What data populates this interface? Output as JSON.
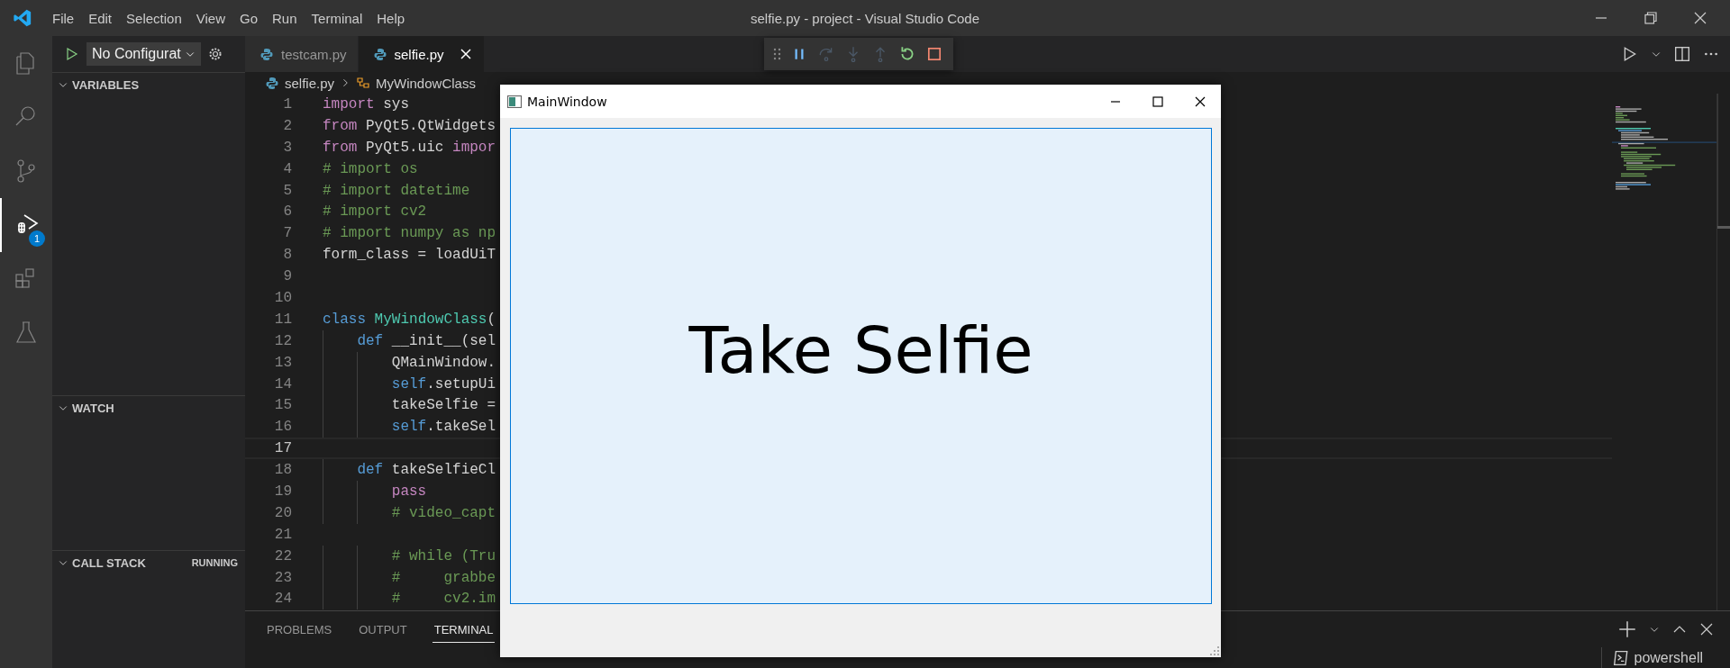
{
  "window": {
    "title": "selfie.py - project - Visual Studio Code",
    "menu": [
      "File",
      "Edit",
      "Selection",
      "View",
      "Go",
      "Run",
      "Terminal",
      "Help"
    ]
  },
  "activity_bar": [
    {
      "kind": "explorer",
      "selected": false
    },
    {
      "kind": "search",
      "selected": false
    },
    {
      "kind": "source_control",
      "selected": false
    },
    {
      "kind": "run_debug",
      "selected": true,
      "badge": "1"
    },
    {
      "kind": "extensions",
      "selected": false
    },
    {
      "kind": "testing",
      "selected": false
    }
  ],
  "debug_config": {
    "value": "No Configurat"
  },
  "sidebar": {
    "sections": [
      {
        "title": "VARIABLES",
        "expanded": true
      },
      {
        "title": "WATCH",
        "expanded": true
      },
      {
        "title": "CALL STACK",
        "expanded": true,
        "status": "RUNNING"
      }
    ]
  },
  "tabs": [
    {
      "label": "testcam.py",
      "selected": false
    },
    {
      "label": "selfie.py",
      "selected": true
    }
  ],
  "debug_toolbar": [
    {
      "kind": "pause",
      "disabled": false
    },
    {
      "kind": "step_over",
      "disabled": true
    },
    {
      "kind": "step_into",
      "disabled": true
    },
    {
      "kind": "step_out",
      "disabled": true
    },
    {
      "kind": "restart",
      "disabled": false
    },
    {
      "kind": "stop",
      "disabled": false
    }
  ],
  "breadcrumb": [
    {
      "kind": "file",
      "label": "selfie.py"
    },
    {
      "kind": "class",
      "label": "MyWindowClass"
    }
  ],
  "code": [
    {
      "number": "1",
      "current": false,
      "tokens": [
        {
          "kind": "keyword",
          "text": "import"
        },
        {
          "kind": "plain",
          "text": " sys"
        }
      ]
    },
    {
      "number": "2",
      "current": false,
      "tokens": [
        {
          "kind": "keyword",
          "text": "from"
        },
        {
          "kind": "plain",
          "text": " PyQt5.QtWidgets"
        }
      ]
    },
    {
      "number": "3",
      "current": false,
      "tokens": [
        {
          "kind": "keyword",
          "text": "from"
        },
        {
          "kind": "plain",
          "text": " PyQt5.uic "
        },
        {
          "kind": "keyword",
          "text": "impor"
        }
      ]
    },
    {
      "number": "4",
      "current": false,
      "tokens": [
        {
          "kind": "comment",
          "text": "# import os"
        }
      ]
    },
    {
      "number": "5",
      "current": false,
      "tokens": [
        {
          "kind": "comment",
          "text": "# import datetime"
        }
      ]
    },
    {
      "number": "6",
      "current": false,
      "tokens": [
        {
          "kind": "comment",
          "text": "# import cv2"
        }
      ]
    },
    {
      "number": "7",
      "current": false,
      "tokens": [
        {
          "kind": "comment",
          "text": "# import numpy as np"
        }
      ]
    },
    {
      "number": "8",
      "current": false,
      "tokens": [
        {
          "kind": "plain",
          "text": "form_class = loadUiT"
        }
      ]
    },
    {
      "number": "9",
      "current": false
    },
    {
      "number": "10",
      "current": false
    },
    {
      "number": "11",
      "current": false,
      "tokens": [
        {
          "kind": "storage",
          "text": "class"
        },
        {
          "kind": "type",
          "text": " MyWindowClass"
        },
        {
          "kind": "plain",
          "text": "("
        }
      ]
    },
    {
      "number": "12",
      "current": false,
      "tokens": [
        {
          "kind": "storage",
          "text": "    def"
        },
        {
          "kind": "plain",
          "text": " __init__(sel"
        }
      ]
    },
    {
      "number": "13",
      "current": false,
      "tokens": [
        {
          "kind": "plain",
          "text": "        QMainWindow."
        }
      ]
    },
    {
      "number": "14",
      "current": false,
      "tokens": [
        {
          "kind": "storage",
          "text": "        self"
        },
        {
          "kind": "plain",
          "text": ".setupUi"
        }
      ]
    },
    {
      "number": "15",
      "current": false,
      "tokens": [
        {
          "kind": "plain",
          "text": "        takeSelfie ="
        }
      ]
    },
    {
      "number": "16",
      "current": false,
      "tokens": [
        {
          "kind": "storage",
          "text": "        self"
        },
        {
          "kind": "plain",
          "text": ".takeSel"
        }
      ]
    },
    {
      "number": "17",
      "current": true
    },
    {
      "number": "18",
      "current": false,
      "tokens": [
        {
          "kind": "storage",
          "text": "    def"
        },
        {
          "kind": "plain",
          "text": " takeSelfieCl"
        }
      ]
    },
    {
      "number": "19",
      "current": false,
      "tokens": [
        {
          "kind": "keyword",
          "text": "        pass"
        }
      ]
    },
    {
      "number": "20",
      "current": false,
      "tokens": [
        {
          "kind": "comment",
          "text": "        # video_capt"
        }
      ]
    },
    {
      "number": "21",
      "current": false
    },
    {
      "number": "22",
      "current": false,
      "tokens": [
        {
          "kind": "comment",
          "text": "        # while (Tru"
        }
      ]
    },
    {
      "number": "23",
      "current": false,
      "tokens": [
        {
          "kind": "comment",
          "text": "        #     grabbe"
        }
      ]
    },
    {
      "number": "24",
      "current": false,
      "tokens": [
        {
          "kind": "comment",
          "text": "        #     cv2.im"
        }
      ]
    }
  ],
  "panel": {
    "tabs": [
      {
        "label": "PROBLEMS",
        "selected": false
      },
      {
        "label": "OUTPUT",
        "selected": false
      },
      {
        "label": "TERMINAL",
        "selected": true
      }
    ],
    "terminal": "powershell"
  },
  "app_window": {
    "title": "MainWindow",
    "button": "Take Selfie"
  }
}
